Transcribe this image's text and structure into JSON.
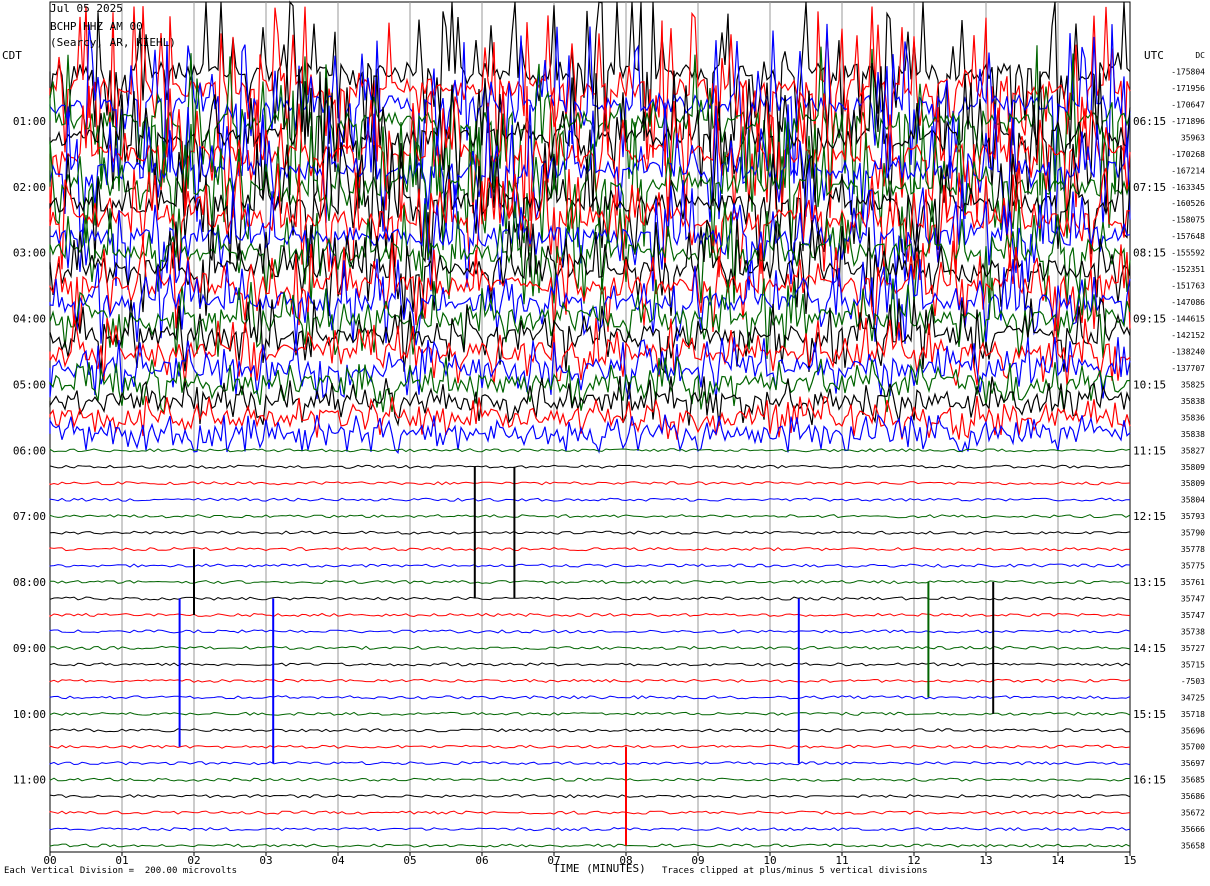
{
  "header": {
    "line1": "Jul 05 2025",
    "line2": "BCHP HHZ AM 00",
    "line3": "(Searcy, AR, KIEHL)"
  },
  "left_tz": "CDT",
  "right_tz": "UTC",
  "xlabel": "TIME (MINUTES)",
  "scale_note": "Each Vertical Division =  200.00 microvolts",
  "clip_note": "Traces clipped at plus/minus 5 vertical divisions",
  "chart_data": {
    "type": "line",
    "title": "",
    "xlabel": "TIME (MINUTES)",
    "ylabel": "",
    "x_ticks": [
      "00",
      "01",
      "02",
      "03",
      "04",
      "05",
      "06",
      "07",
      "08",
      "09",
      "10",
      "11",
      "12",
      "13",
      "14",
      "15"
    ],
    "xlim": [
      0,
      15
    ],
    "grid": true,
    "left_time_labels": [
      "01:00",
      "02:00",
      "03:00",
      "04:00",
      "05:00",
      "06:00",
      "07:00",
      "08:00",
      "09:00",
      "10:00",
      "11:00"
    ],
    "right_time_labels": [
      "06:15",
      "07:15",
      "08:15",
      "09:15",
      "10:15",
      "11:15",
      "12:15",
      "13:15",
      "14:15",
      "15:15",
      "16:15"
    ],
    "trace_colors": [
      "#000000",
      "#ff0000",
      "#0000ff",
      "#006400"
    ],
    "row_values": [
      "DC",
      "-175804",
      "-171956",
      "-170647",
      "-171896",
      "35963",
      "-170268",
      "-167214",
      "-163345",
      "-160526",
      "-158075",
      "-157648",
      "-155592",
      "-152351",
      "-151763",
      "-147086",
      "-144615",
      "-142152",
      "-138240",
      "-137707",
      "35825",
      "35838",
      "35836",
      "35838",
      "35827",
      "35809",
      "35809",
      "35804",
      "35793",
      "35790",
      "35778",
      "35775",
      "35761",
      "35747",
      "35747",
      "35738",
      "35727",
      "35715",
      "-7503",
      "34725",
      "35718",
      "35696",
      "35700",
      "35697",
      "35685",
      "35686",
      "35672",
      "35666",
      "35658"
    ]
  }
}
